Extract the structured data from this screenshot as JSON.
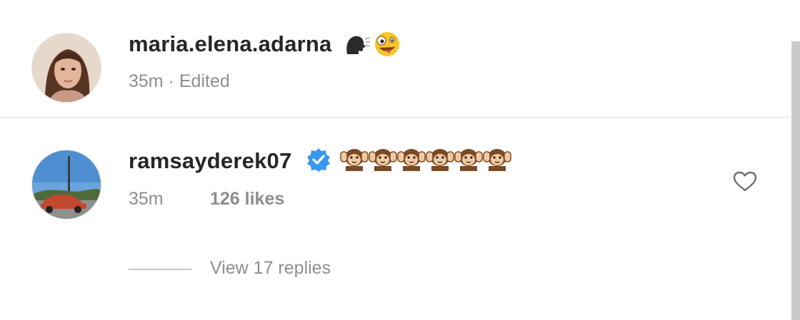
{
  "comment1": {
    "username": "maria.elena.adarna",
    "time": "35m",
    "separator": "·",
    "edited": "Edited",
    "emoji_icons": [
      "speaking-head-icon",
      "zany-face-icon"
    ]
  },
  "comment2": {
    "username": "ramsayderek07",
    "verified_icon": "verified-badge-icon",
    "emoji_icons": [
      "hear-no-evil-monkey-icon",
      "hear-no-evil-monkey-icon",
      "hear-no-evil-monkey-icon",
      "hear-no-evil-monkey-icon",
      "hear-no-evil-monkey-icon",
      "hear-no-evil-monkey-icon"
    ],
    "time": "35m",
    "likes": "126 likes",
    "like_icon": "heart-outline-icon"
  },
  "replies": {
    "label": "View 17 replies"
  },
  "colors": {
    "text_primary": "#262626",
    "text_secondary": "#8e8e8e",
    "verified_blue": "#3897f0",
    "divider": "#dbdbdb"
  }
}
